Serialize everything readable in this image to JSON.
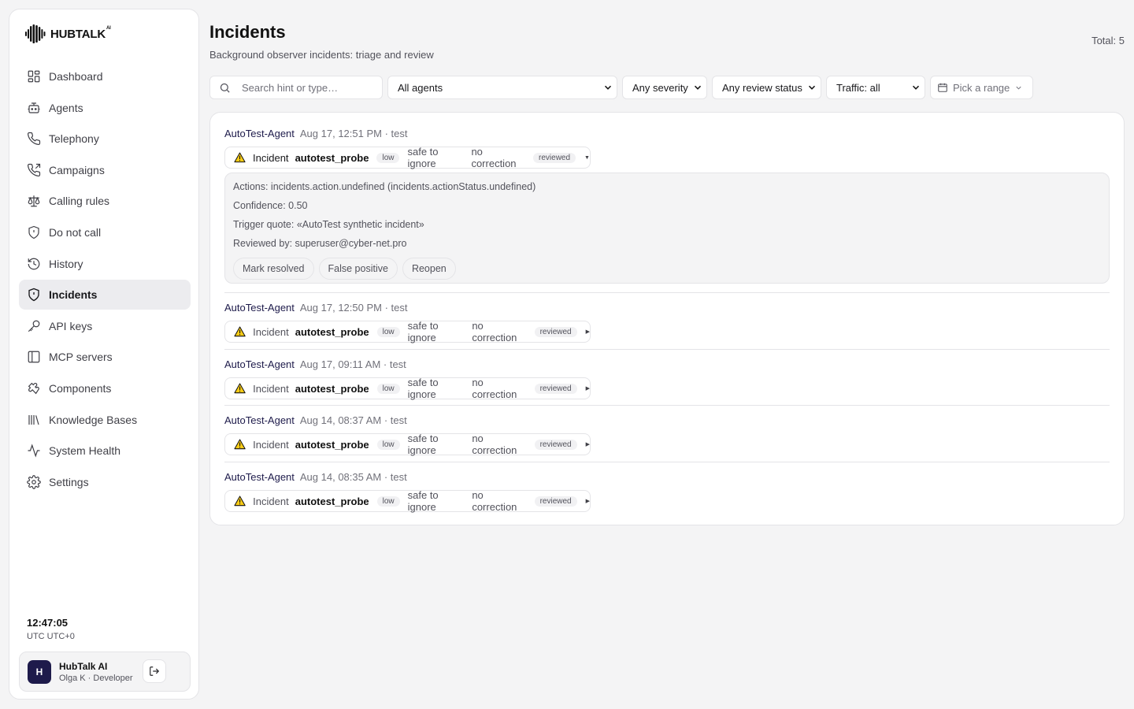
{
  "brand": {
    "name": "HUBTALK",
    "suffix": "AI"
  },
  "sidebar": {
    "items": [
      {
        "label": "Dashboard",
        "icon": "layout-grid-icon"
      },
      {
        "label": "Agents",
        "icon": "bot-icon"
      },
      {
        "label": "Telephony",
        "icon": "phone-icon"
      },
      {
        "label": "Campaigns",
        "icon": "phone-outgoing-icon"
      },
      {
        "label": "Calling rules",
        "icon": "scale-icon"
      },
      {
        "label": "Do not call",
        "icon": "shield-icon"
      },
      {
        "label": "History",
        "icon": "history-icon"
      },
      {
        "label": "Incidents",
        "icon": "shield-alert-icon",
        "active": true
      },
      {
        "label": "API keys",
        "icon": "key-icon"
      },
      {
        "label": "MCP servers",
        "icon": "panel-icon"
      },
      {
        "label": "Components",
        "icon": "puzzle-icon"
      },
      {
        "label": "Knowledge Bases",
        "icon": "library-icon"
      },
      {
        "label": "System Health",
        "icon": "activity-icon"
      },
      {
        "label": "Settings",
        "icon": "gear-icon"
      }
    ],
    "clock": {
      "time": "12:47:05",
      "timezone": "UTC UTC+0"
    },
    "user": {
      "initial": "H",
      "org": "HubTalk AI",
      "person": "Olga K · Developer"
    }
  },
  "header": {
    "title": "Incidents",
    "subtitle": "Background observer incidents: triage and review",
    "total": "Total: 5"
  },
  "filters": {
    "search_placeholder": "Search hint or type…",
    "agents": "All agents",
    "severity": "Any severity",
    "review_status": "Any review status",
    "traffic": "Traffic: all",
    "range_placeholder": "Pick a range"
  },
  "incidents": [
    {
      "agent": "AutoTest-Agent",
      "meta": "Aug 17, 12:51 PM · test",
      "label": "Incident",
      "code": "autotest_probe",
      "severity": "low",
      "safety": "safe to ignore",
      "correction": "no correction",
      "review": "reviewed",
      "expanded": true
    },
    {
      "agent": "AutoTest-Agent",
      "meta": "Aug 17, 12:50 PM · test",
      "label": "Incident",
      "code": "autotest_probe",
      "severity": "low",
      "safety": "safe to ignore",
      "correction": "no correction",
      "review": "reviewed"
    },
    {
      "agent": "AutoTest-Agent",
      "meta": "Aug 17, 09:11 AM · test",
      "label": "Incident",
      "code": "autotest_probe",
      "severity": "low",
      "safety": "safe to ignore",
      "correction": "no correction",
      "review": "reviewed"
    },
    {
      "agent": "AutoTest-Agent",
      "meta": "Aug 14, 08:37 AM · test",
      "label": "Incident",
      "code": "autotest_probe",
      "severity": "low",
      "safety": "safe to ignore",
      "correction": "no correction",
      "review": "reviewed"
    },
    {
      "agent": "AutoTest-Agent",
      "meta": "Aug 14, 08:35 AM · test",
      "label": "Incident",
      "code": "autotest_probe",
      "severity": "low",
      "safety": "safe to ignore",
      "correction": "no correction",
      "review": "reviewed"
    }
  ],
  "details": {
    "actions": "Actions: incidents.action.undefined (incidents.actionStatus.undefined)",
    "confidence": "Confidence: 0.50",
    "trigger": "Trigger quote: «AutoTest synthetic incident»",
    "reviewed_by": "Reviewed by: superuser@cyber-net.pro",
    "buttons": {
      "resolve": "Mark resolved",
      "false_positive": "False positive",
      "reopen": "Reopen"
    }
  },
  "colors": {
    "accent": "#1e1b4b",
    "warning": "#facc15",
    "active_bg": "#ececef"
  }
}
